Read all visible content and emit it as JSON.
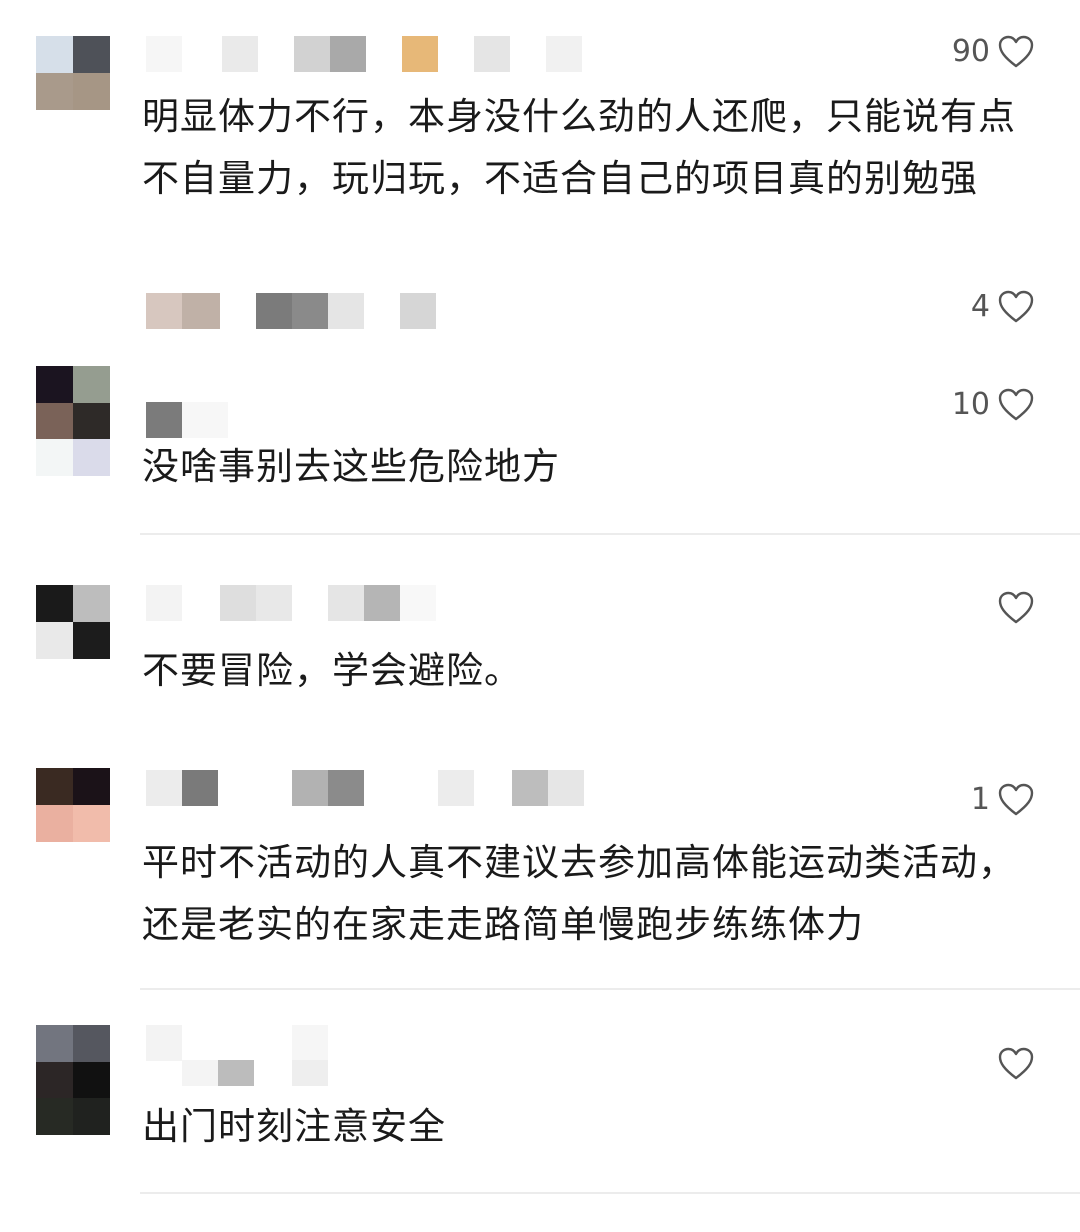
{
  "comments": [
    {
      "likes": "90",
      "text": "明显体力不行，本身没什么劲的人还爬，只能说有点不自量力，玩归玩，不适合自己的项目真的别勉强",
      "reply_likes": "4"
    },
    {
      "likes": "10",
      "text": "没啥事别去这些危险地方"
    },
    {
      "likes": "",
      "text": "不要冒险，学会避险。"
    },
    {
      "likes": "1",
      "text": "平时不活动的人真不建议去参加高体能运动类活动，还是老实的在家走走路简单慢跑步练练体力"
    },
    {
      "likes": "",
      "text": "出门时刻注意安全"
    }
  ],
  "icons": {
    "like": "heart-outline-icon"
  },
  "colors": {
    "text": "#1a1a1a",
    "muted": "#555555",
    "divider": "#ececec"
  }
}
